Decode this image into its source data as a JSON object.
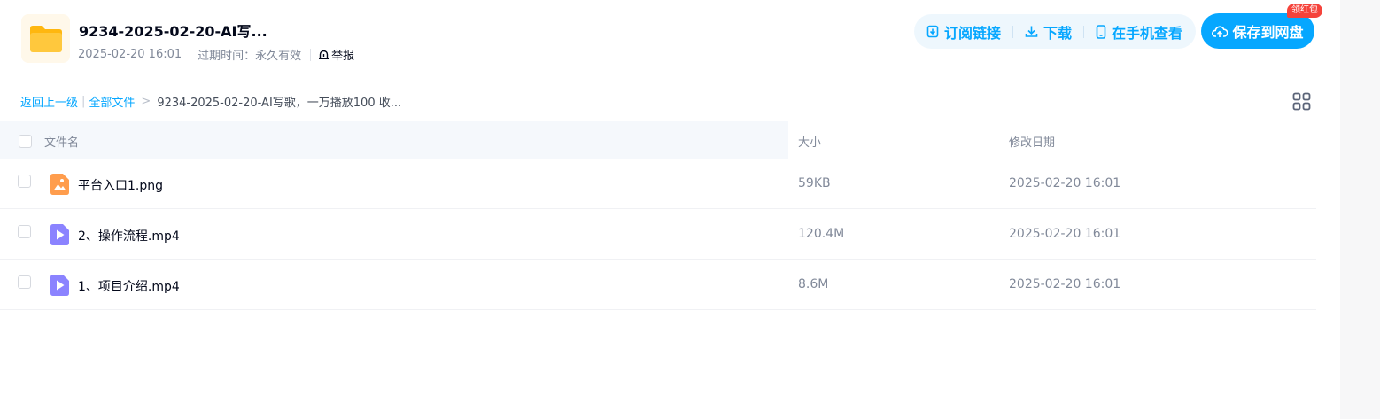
{
  "share": {
    "title": "9234-2025-02-20-AI写...",
    "created": "2025-02-20 16:01",
    "expire_label": "过期时间：永久有效",
    "report_label": "举报"
  },
  "actions": {
    "subscribe_label": "订阅链接",
    "download_label": "下载",
    "mobile_label": "在手机查看",
    "save_label": "保存到网盘",
    "badge_label": "领红包"
  },
  "breadcrumb": {
    "back_label": "返回上一级",
    "all_files_label": "全部文件",
    "current": "9234-2025-02-20-AI写歌，一万播放100 收..."
  },
  "table": {
    "columns": {
      "name": "文件名",
      "size": "大小",
      "date": "修改日期"
    },
    "rows": [
      {
        "name": "平台入口1.png",
        "size": "59KB",
        "date": "2025-02-20 16:01",
        "icon": "image-file-icon"
      },
      {
        "name": "2、操作流程.mp4",
        "size": "120.4M",
        "date": "2025-02-20 16:01",
        "icon": "video-file-icon"
      },
      {
        "name": "1、项目介绍.mp4",
        "size": "8.6M",
        "date": "2025-02-20 16:01",
        "icon": "video-file-icon"
      }
    ]
  },
  "colors": {
    "accent": "#06a7ff",
    "badge": "#f5433b",
    "image_icon": "#ff9d4d",
    "video_icon": "#8b83ff",
    "folder": "#ffc83d"
  }
}
